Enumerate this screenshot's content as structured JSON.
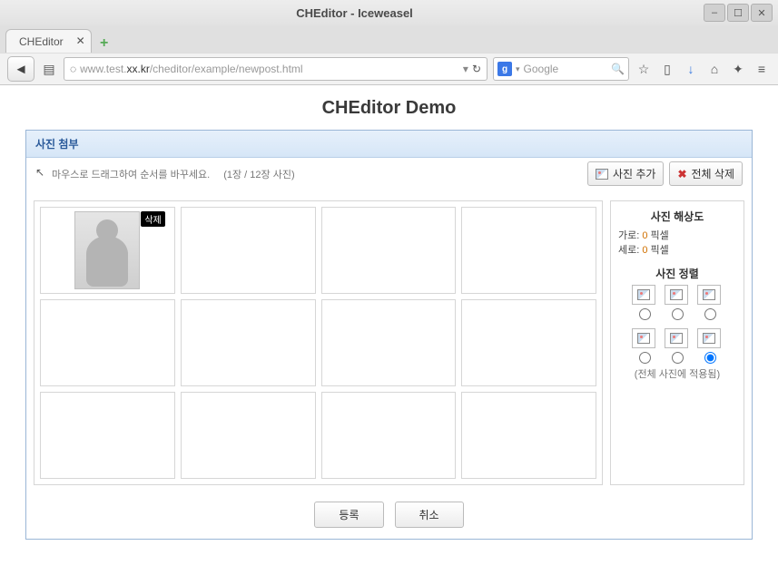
{
  "window": {
    "title": "CHEditor - Iceweasel"
  },
  "tabs": [
    {
      "label": "CHEditor"
    }
  ],
  "url": {
    "prefix": "www.test.",
    "host": "xx.kr",
    "path": "/cheditor/example/newpost.html"
  },
  "search": {
    "engine": "g",
    "placeholder": "Google"
  },
  "page": {
    "title": "CHEditor Demo"
  },
  "panel": {
    "title": "사진 첨부",
    "tip": "마우스로 드래그하여 순서를 바꾸세요.",
    "count": "(1장 / 12장 사진)",
    "add_btn": "사진 추가",
    "delete_all_btn": "전체 삭제",
    "delete_badge": "삭제",
    "submit_btn": "등록",
    "cancel_btn": "취소"
  },
  "side": {
    "resolution_title": "사진 해상도",
    "width_label": "가로:",
    "width_value": "0",
    "width_unit": "픽셀",
    "height_label": "세로:",
    "height_value": "0",
    "height_unit": "픽셀",
    "align_title": "사진 정렬",
    "apply_note": "(전체 사진에 적용됨)"
  }
}
